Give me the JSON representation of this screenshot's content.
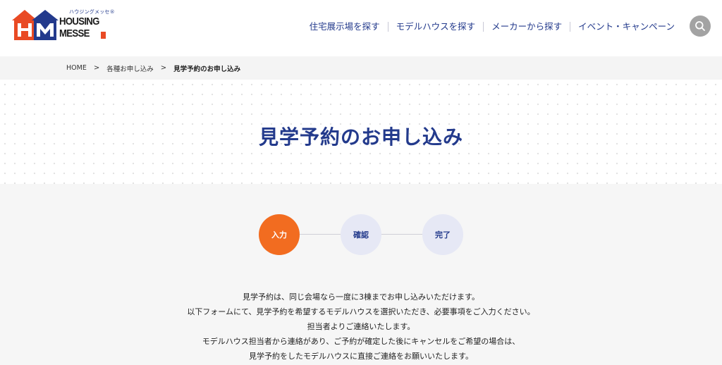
{
  "header": {
    "logo": {
      "kana": "ハウジングメッセ®",
      "line1": "HOUSING",
      "line2": "MESSE",
      "icon": "house-logo-icon"
    },
    "nav": [
      {
        "label": "住宅展示場を探す"
      },
      {
        "label": "モデルハウスを探す"
      },
      {
        "label": "メーカーから探す"
      },
      {
        "label": "イベント・キャンペーン"
      }
    ],
    "search_icon": "search-icon"
  },
  "breadcrumb": {
    "items": [
      "HOME",
      "各種お申し込み",
      "見学予約のお申し込み"
    ],
    "separator": ">"
  },
  "page": {
    "title": "見学予約のお申し込み"
  },
  "steps": [
    {
      "label": "入力",
      "active": true
    },
    {
      "label": "確認",
      "active": false
    },
    {
      "label": "完了",
      "active": false
    }
  ],
  "intro": [
    "見学予約は、同じ会場なら一度に3棟までお申し込みいただけます。",
    "以下フォームにて、見学予約を希望するモデルハウスを選択いただき、必要事項をご入力ください。",
    "担当者よりご連絡いたします。",
    "モデルハウス担当者から連絡があり、ご予約が確定した後にキャンセルをご希望の場合は、",
    "見学予約をしたモデルハウスに直接ご連絡をお願いいたします。"
  ],
  "colors": {
    "brand_navy": "#233a8c",
    "accent_orange": "#f26c20",
    "logo_orange": "#e94a24",
    "step_inactive": "#e6e8f5"
  }
}
